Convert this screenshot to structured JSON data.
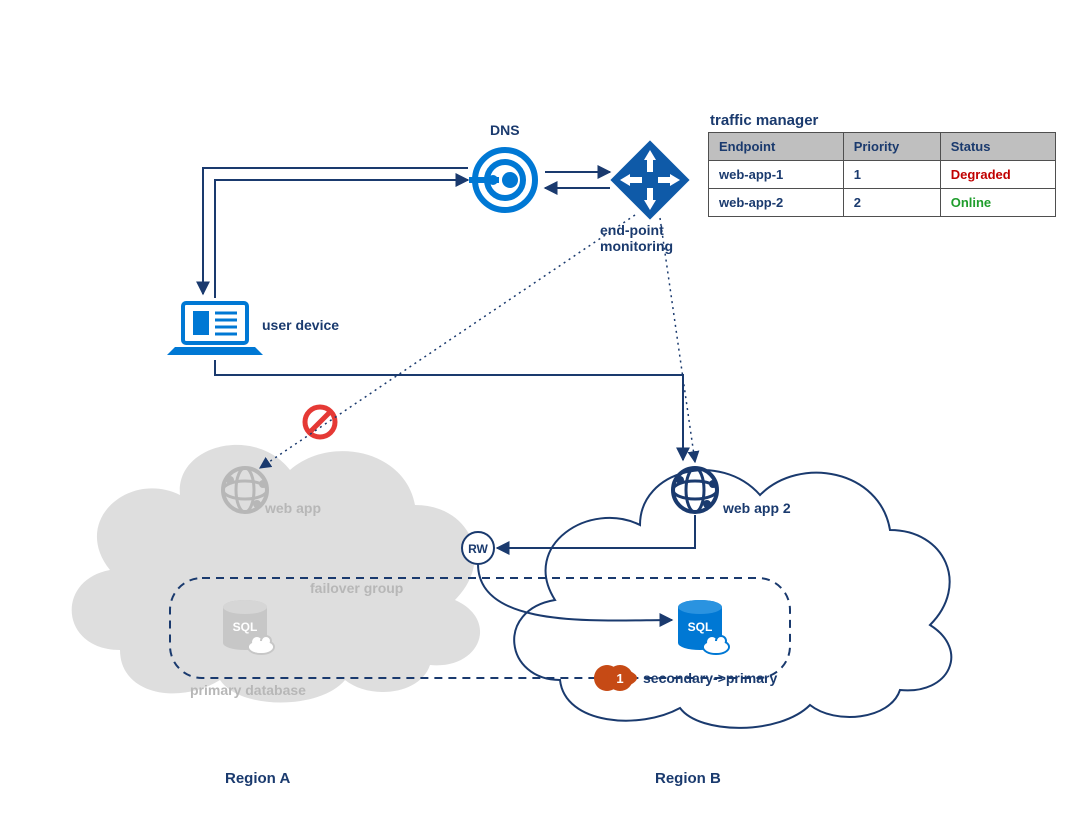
{
  "labels": {
    "dns": "DNS",
    "traffic_manager_title": "traffic manager",
    "endpoint_monitoring": "end-point\nmonitoring",
    "user_device": "user device",
    "web_app_a": "web app",
    "web_app_b": "web app 2",
    "rw": "RW",
    "failover_group": "failover group",
    "primary_db": "primary database",
    "secondary_db": "secondary->primary",
    "region_a": "Region A",
    "region_b": "Region B",
    "callout_1": "1"
  },
  "traffic_manager": {
    "headers": {
      "endpoint": "Endpoint",
      "priority": "Priority",
      "status": "Status"
    },
    "rows": [
      {
        "endpoint": "web-app-1",
        "priority": "1",
        "status": "Degraded",
        "status_class": "status-degraded"
      },
      {
        "endpoint": "web-app-2",
        "priority": "2",
        "status": "Online",
        "status_class": "status-online"
      }
    ]
  },
  "colors": {
    "navy": "#1a3a6e",
    "azure": "#0078d4",
    "faded": "#c7c7c7",
    "cloudA": "#dedede",
    "red": "#e53935",
    "orange": "#c64a15",
    "black": "#000000"
  }
}
